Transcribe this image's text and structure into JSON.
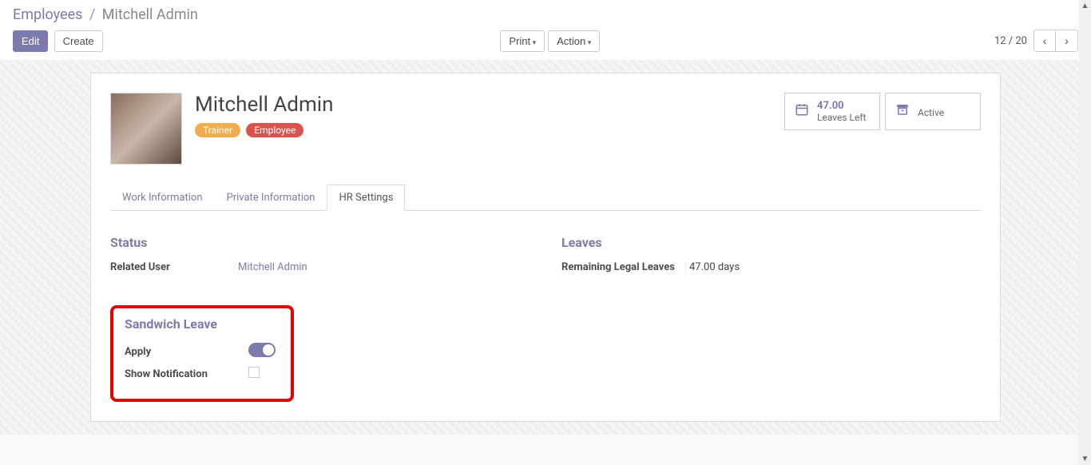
{
  "breadcrumb": {
    "root": "Employees",
    "sep": "/",
    "current": "Mitchell Admin"
  },
  "toolbar": {
    "edit": "Edit",
    "create": "Create",
    "print": "Print",
    "action": "Action",
    "pager": "12 / 20"
  },
  "employee": {
    "name": "Mitchell Admin",
    "tags": {
      "trainer": "Trainer",
      "employee": "Employee"
    }
  },
  "stats": {
    "leaves_value": "47.00",
    "leaves_label": "Leaves Left",
    "active_label": "Active"
  },
  "tabs": {
    "work_info": "Work Information",
    "private_info": "Private Information",
    "hr_settings": "HR Settings"
  },
  "status": {
    "title": "Status",
    "related_user_label": "Related User",
    "related_user_value": "Mitchell Admin"
  },
  "leaves": {
    "title": "Leaves",
    "remaining_label": "Remaining Legal Leaves",
    "remaining_value": "47.00 days"
  },
  "sandwich": {
    "title": "Sandwich Leave",
    "apply_label": "Apply",
    "show_notification_label": "Show Notification"
  }
}
